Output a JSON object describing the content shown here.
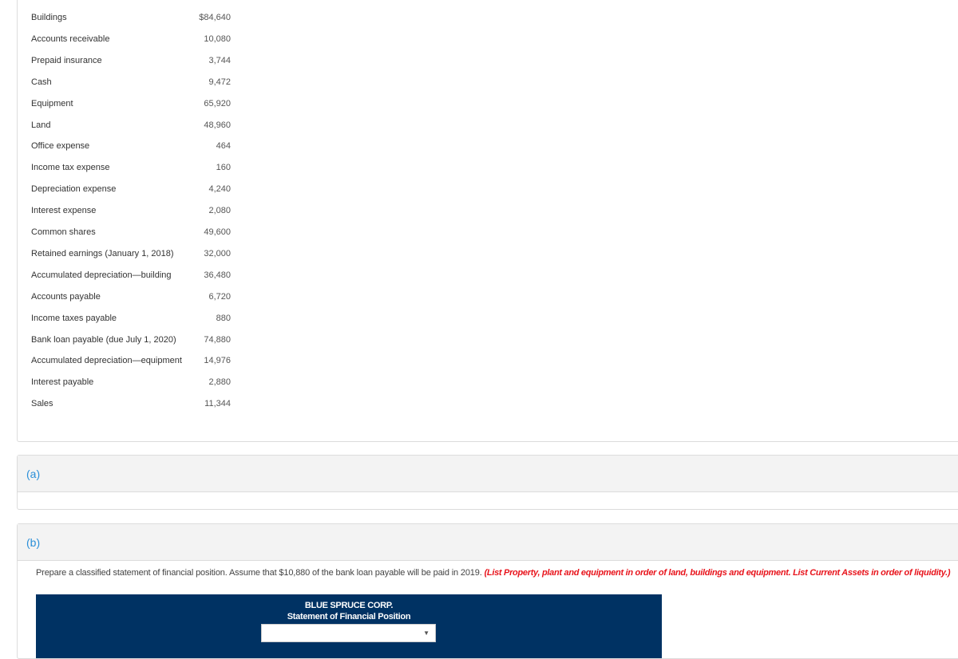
{
  "accounts": [
    {
      "name": "Buildings",
      "value": "$84,640"
    },
    {
      "name": "Accounts receivable",
      "value": "10,080"
    },
    {
      "name": "Prepaid insurance",
      "value": "3,744"
    },
    {
      "name": "Cash",
      "value": "9,472"
    },
    {
      "name": "Equipment",
      "value": "65,920"
    },
    {
      "name": "Land",
      "value": "48,960"
    },
    {
      "name": "Office expense",
      "value": "464"
    },
    {
      "name": "Income tax expense",
      "value": "160"
    },
    {
      "name": "Depreciation expense",
      "value": "4,240"
    },
    {
      "name": "Interest expense",
      "value": "2,080"
    },
    {
      "name": "Common shares",
      "value": "49,600"
    },
    {
      "name": "Retained earnings (January 1, 2018)",
      "value": "32,000"
    },
    {
      "name": "Accumulated depreciation—building",
      "value": "36,480"
    },
    {
      "name": "Accounts payable",
      "value": "6,720"
    },
    {
      "name": "Income taxes payable",
      "value": "880"
    },
    {
      "name": "Bank loan payable  (due July 1, 2020)",
      "value": "74,880"
    },
    {
      "name": "Accumulated depreciation—equipment",
      "value": "14,976"
    },
    {
      "name": "Interest payable",
      "value": "2,880"
    },
    {
      "name": "Sales",
      "value": "11,344"
    }
  ],
  "part_a": {
    "label": "(a)"
  },
  "part_b": {
    "label": "(b)",
    "instructions": "Prepare a classified statement of financial position. Assume that $10,880 of the bank loan payable will be paid in 2019. ",
    "instructions_emphasis": "(List Property, plant and equipment in order of land, buildings and equipment. List Current Assets in order of liquidity.)",
    "statement": {
      "company": "BLUE SPRUCE CORP.",
      "title": "Statement of Financial Position",
      "date_select": {
        "value": "",
        "arrow_icon": "▼"
      }
    }
  },
  "colors": {
    "statement_header_bg": "#003263",
    "part_label": "#2a8fd9",
    "emphasis_red": "#e8141c"
  }
}
